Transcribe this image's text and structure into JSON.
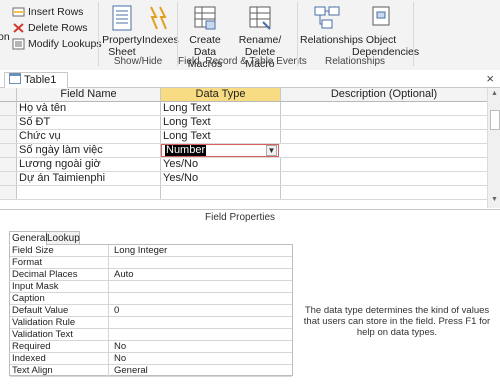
{
  "ribbon": {
    "small_commands": [
      {
        "label": "Insert Rows",
        "icon": "insert-rows-icon"
      },
      {
        "label": "Delete Rows",
        "icon": "delete-rows-icon"
      },
      {
        "label": "Modify Lookups",
        "icon": "modify-lookups-icon"
      }
    ],
    "left_cut_label": "on",
    "show_hide": {
      "property_sheet": "Property Sheet",
      "indexes": "Indexes",
      "group_label": "Show/Hide"
    },
    "field_record_table_events": {
      "create_data_macros": "Create Data Macros",
      "rename_delete_macro": "Rename/ Delete Macro",
      "group_label": "Field, Record & Table Events"
    },
    "relationships_group": {
      "relationships": "Relationships",
      "object_dependencies": "Object Dependencies",
      "group_label": "Relationships"
    }
  },
  "document_tab": {
    "label": "Table1",
    "close": "×"
  },
  "grid": {
    "headers": {
      "field_name": "Field Name",
      "data_type": "Data Type",
      "description": "Description (Optional)"
    },
    "rows": [
      {
        "field_name": "Họ và tên",
        "data_type": "Long Text"
      },
      {
        "field_name": "Số ĐT",
        "data_type": "Long Text"
      },
      {
        "field_name": "Chức vụ",
        "data_type": "Long Text"
      },
      {
        "field_name": "Số ngày làm việc",
        "data_type": "Number"
      },
      {
        "field_name": "Lương ngoài giờ",
        "data_type": "Yes/No"
      },
      {
        "field_name": "Dự án Taimienphi",
        "data_type": "Yes/No"
      }
    ],
    "active_row_index": 3
  },
  "field_properties": {
    "title": "Field Properties",
    "tabs": [
      "General",
      "Lookup"
    ],
    "active_tab": "General",
    "rows": [
      {
        "name": "Field Size",
        "value": "Long Integer"
      },
      {
        "name": "Format",
        "value": ""
      },
      {
        "name": "Decimal Places",
        "value": "Auto"
      },
      {
        "name": "Input Mask",
        "value": ""
      },
      {
        "name": "Caption",
        "value": ""
      },
      {
        "name": "Default Value",
        "value": "0"
      },
      {
        "name": "Validation Rule",
        "value": ""
      },
      {
        "name": "Validation Text",
        "value": ""
      },
      {
        "name": "Required",
        "value": "No"
      },
      {
        "name": "Indexed",
        "value": "No"
      },
      {
        "name": "Text Align",
        "value": "General"
      }
    ],
    "help_text": "The data type determines the kind of values that users can store in the field. Press F1 for help on data types."
  },
  "colors": {
    "selected_header": "#f8dc83",
    "active_border": "#d46060",
    "ribbon_bg": "#f3f3f3"
  }
}
